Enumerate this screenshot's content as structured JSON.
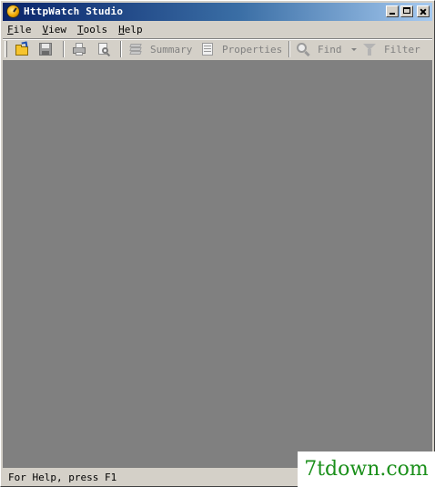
{
  "window": {
    "title": "HttpWatch Studio"
  },
  "menu": {
    "items": [
      {
        "hotkey": "F",
        "rest": "ile"
      },
      {
        "hotkey": "V",
        "rest": "iew"
      },
      {
        "hotkey": "T",
        "rest": "ools"
      },
      {
        "hotkey": "H",
        "rest": "elp"
      }
    ]
  },
  "toolbar": {
    "summary_label": "Summary",
    "properties_label": "Properties",
    "find_label": "Find",
    "filter_label": "Filter",
    "icons": [
      "open-icon",
      "save-icon",
      "print-icon",
      "print-preview-icon",
      "summary-icon",
      "properties-icon",
      "find-icon",
      "filter-icon"
    ]
  },
  "status": {
    "help_text": "For Help, press F1"
  },
  "watermark": {
    "text": "7tdown.com",
    "color": "#1a8f1a"
  },
  "colors": {
    "workspace": "#808080",
    "chrome": "#d4d0c8",
    "titlebar_start": "#0a246a",
    "titlebar_end": "#a6caf0"
  }
}
